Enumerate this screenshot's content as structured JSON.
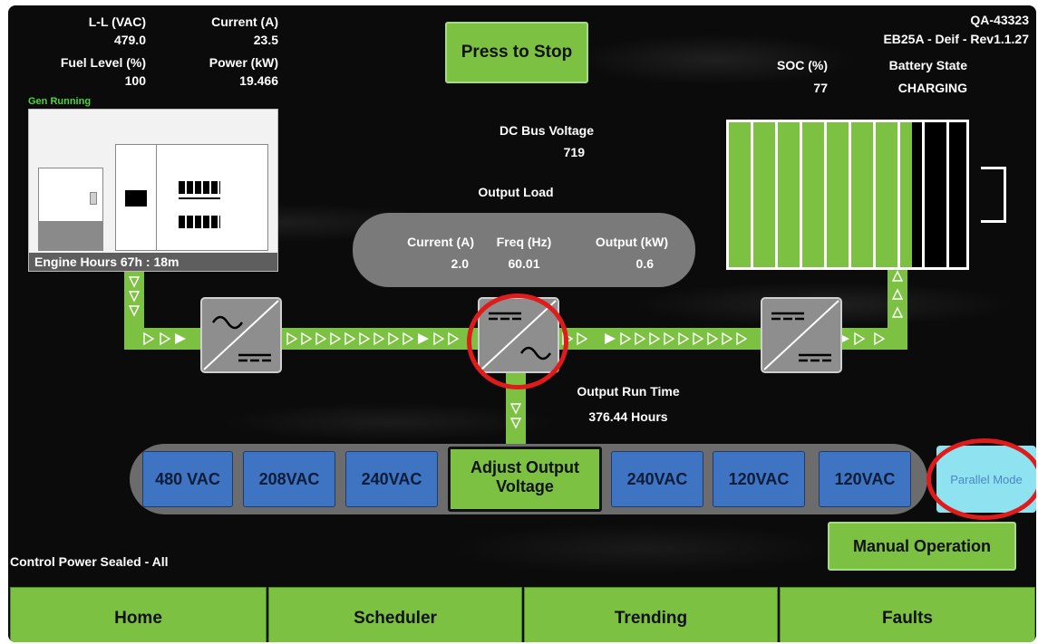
{
  "top_left": {
    "ll_label": "L-L (VAC)",
    "ll_value": "479.0",
    "current_label": "Current (A)",
    "current_value": "23.5",
    "fuel_label": "Fuel Level (%)",
    "fuel_value": "100",
    "power_label": "Power (kW)",
    "power_value": "19.466",
    "gen_status": "Gen Running"
  },
  "generator": {
    "engine_hours": "Engine Hours 67h : 18m"
  },
  "stop_button": "Press to Stop",
  "top_right": {
    "unit_id": "QA-43323",
    "revision": "EB25A - Deif - Rev1.1.27",
    "soc_label": "SOC (%)",
    "soc_value": "77",
    "battery_state_label": "Battery State",
    "battery_state_value": "CHARGING"
  },
  "battery": {
    "fill_fraction": 0.77,
    "fill_color": "#7cc142"
  },
  "dc_bus": {
    "label": "DC Bus Voltage",
    "value": "719"
  },
  "output_load": {
    "title": "Output Load",
    "current_label": "Current (A)",
    "current_value": "2.0",
    "freq_label": "Freq (Hz)",
    "freq_value": "60.01",
    "kw_label": "Output (kW)",
    "kw_value": "0.6"
  },
  "run_time": {
    "label": "Output Run Time",
    "value": "376.44 Hours"
  },
  "voltage_buttons": [
    "480 VAC",
    "208VAC",
    "240VAC",
    "240VAC",
    "120VAC",
    "120VAC"
  ],
  "adjust_output": {
    "line1": "Adjust Output",
    "line2": "Voltage"
  },
  "parallel_mode": "Parallel Mode",
  "manual_operation": "Manual Operation",
  "control_power": "Control Power Sealed - All",
  "nav": [
    "Home",
    "Scheduler",
    "Trending",
    "Faults"
  ],
  "colors": {
    "accent_green": "#7cc142",
    "button_blue": "#3f74c2",
    "highlight_red": "#e01b1b",
    "parallel_cyan": "#8fe3f0"
  },
  "icons": [
    "ac-dc-converter-icon",
    "dc-ac-inverter-icon",
    "dc-dc-converter-icon",
    "flow-arrow-icon"
  ]
}
